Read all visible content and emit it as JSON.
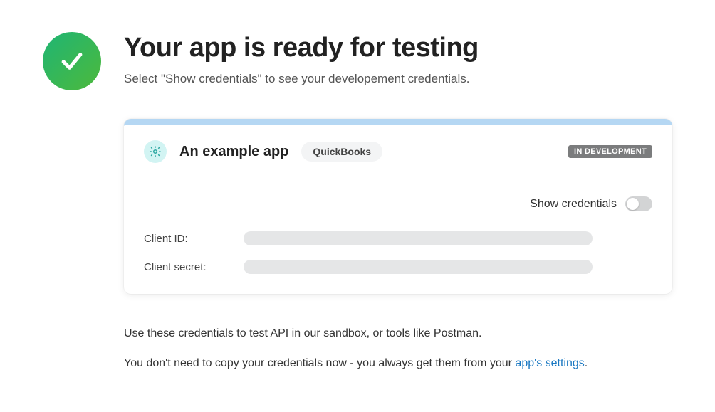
{
  "header": {
    "title": "Your app is ready for testing",
    "subtitle": "Select \"Show credentials\" to see your developement credentials."
  },
  "card": {
    "app_name": "An example app",
    "app_tag": "QuickBooks",
    "status": "IN DEVELOPMENT",
    "toggle_label": "Show credentials",
    "toggle_on": false,
    "credentials": {
      "client_id_label": "Client ID:",
      "client_secret_label": "Client secret:"
    }
  },
  "footer": {
    "line1": "Use these credentials to test API in our sandbox, or tools like Postman.",
    "line2_a": "You don't need to copy your credentials now - you always get them from your ",
    "line2_link": "app's settings",
    "line2_b": "."
  }
}
